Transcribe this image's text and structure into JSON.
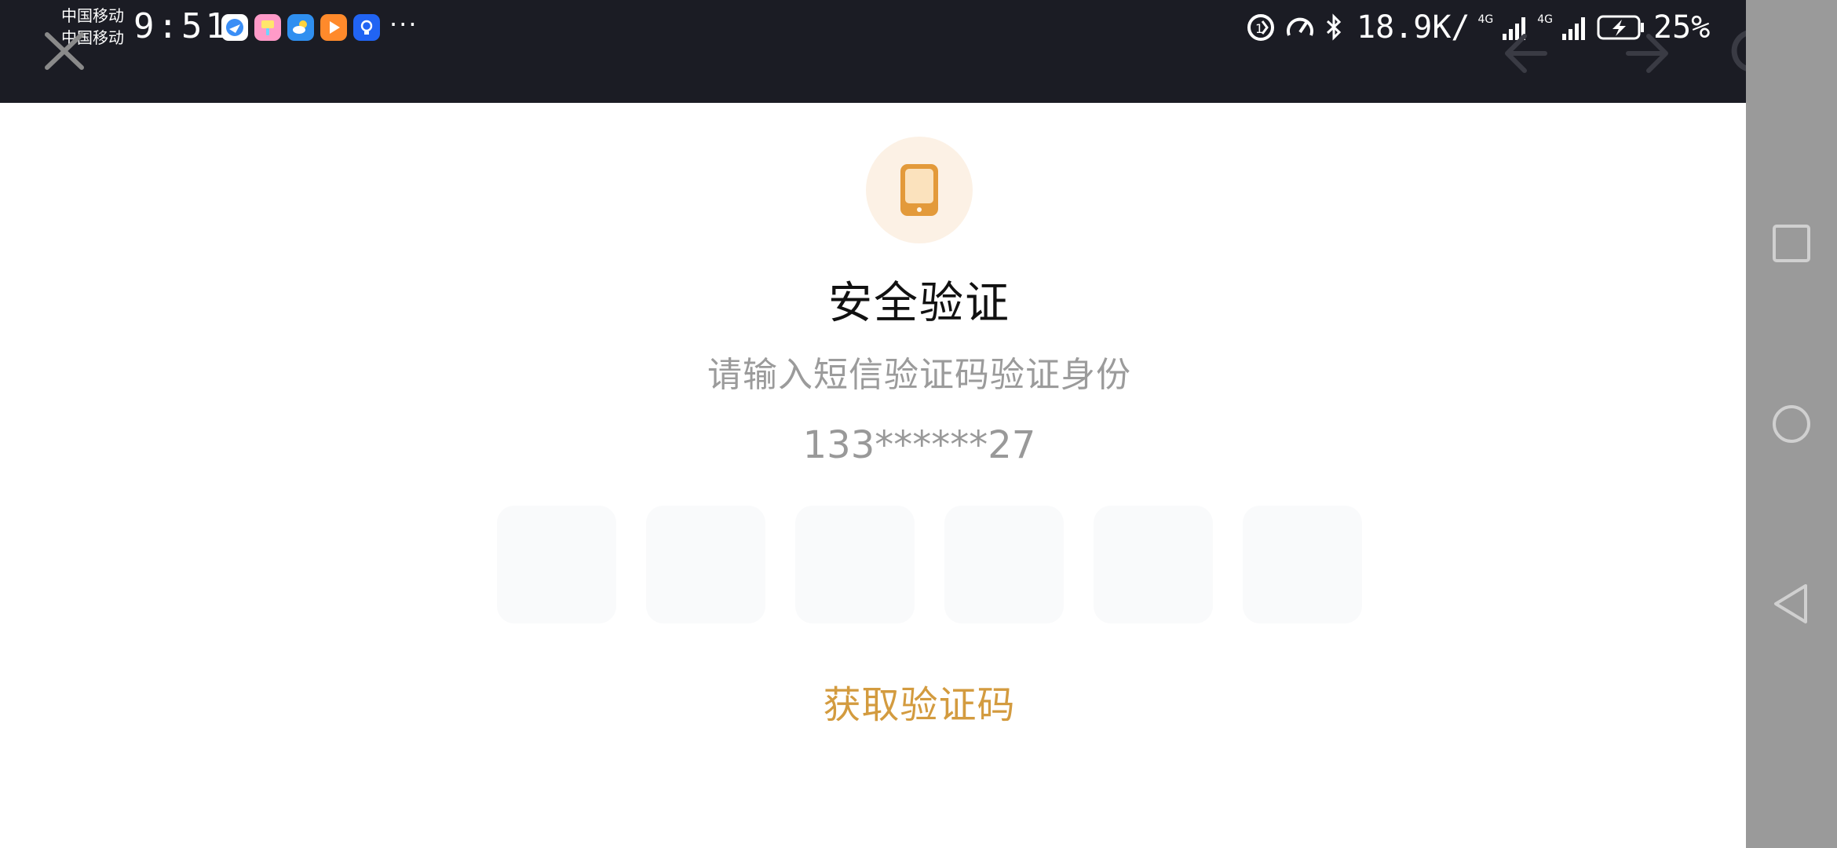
{
  "status_bar": {
    "carrier_1": "中国移动",
    "carrier_2": "中国移动",
    "time": "9:51",
    "more": "···",
    "net_speed": "18.9K/",
    "net_type_1": "4G",
    "net_type_2": "4G",
    "battery": "25%"
  },
  "verification": {
    "title": "安全验证",
    "subtitle": "请输入短信验证码验证身份",
    "phone": "133******27",
    "code_count": 6,
    "get_code_label": "获取验证码"
  },
  "colors": {
    "accent": "#d39b3f",
    "topbar": "#1b1c24",
    "sidepanel": "#9a9a9a",
    "icon_bg": "#fcf1e5"
  },
  "icons": {
    "close": "close-icon",
    "back": "arrow-left-icon",
    "forward": "arrow-right-icon",
    "refresh": "refresh-icon",
    "phone": "phone-icon",
    "nav_square": "recent-apps-icon",
    "nav_circle": "home-icon",
    "nav_triangle": "back-nav-icon"
  }
}
